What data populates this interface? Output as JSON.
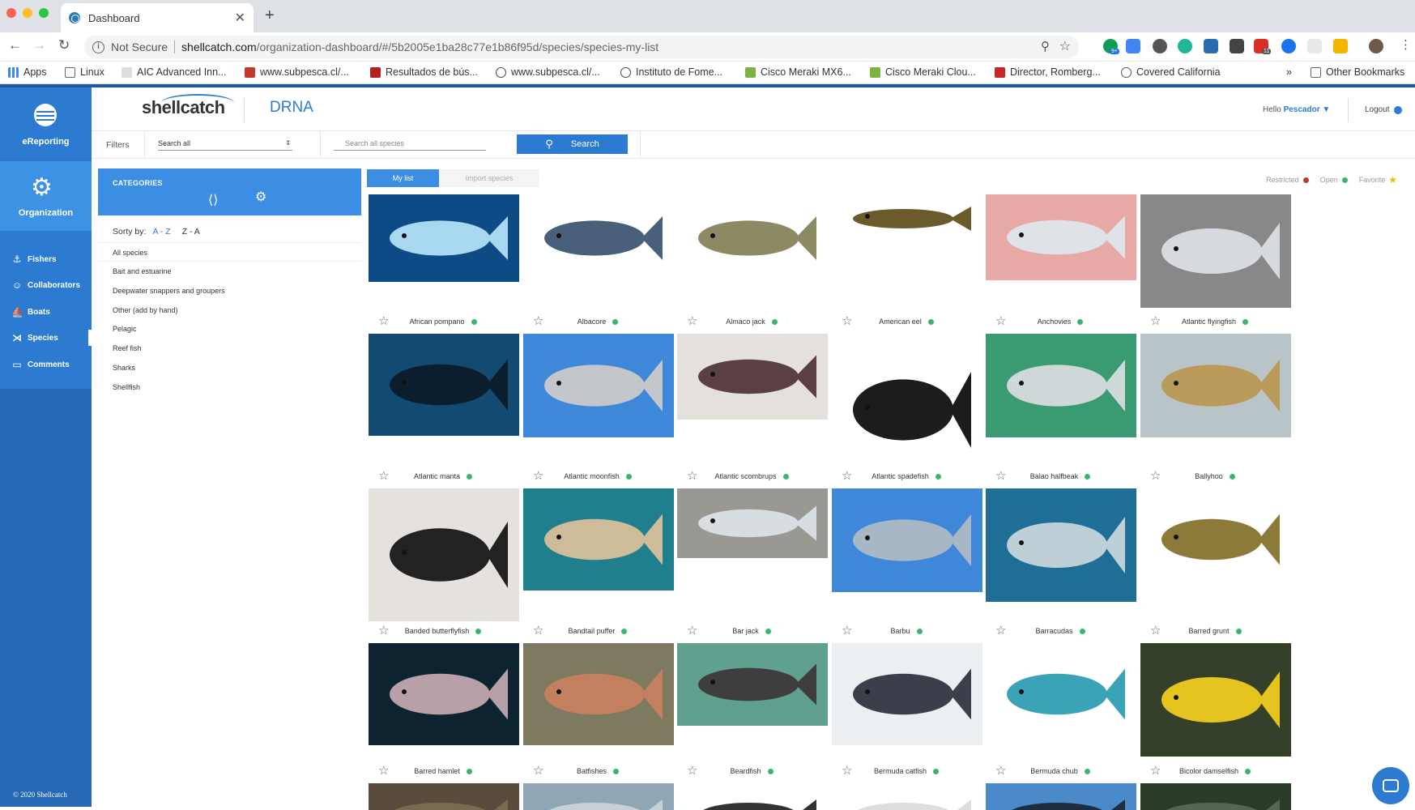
{
  "browser": {
    "tab_title": "Dashboard",
    "security": "Not Secure",
    "url_host": "shellcatch.com",
    "url_path": "/organization-dashboard/#/5b2005e1ba28c77e1b86f95d/species/species-my-list",
    "ext_badge_1": "9+",
    "ext_badge_2": "11",
    "bookmarks": [
      {
        "label": "Apps",
        "color": "#4285f4"
      },
      {
        "label": "Linux",
        "color": "#777777"
      },
      {
        "label": "AIC Advanced Inn...",
        "color": "#555555"
      },
      {
        "label": "www.subpesca.cl/...",
        "color": "#c0392b"
      },
      {
        "label": "Resultados de bús...",
        "color": "#b22222"
      },
      {
        "label": "www.subpesca.cl/...",
        "color": "#444444"
      },
      {
        "label": "Instituto de Fome...",
        "color": "#444444"
      },
      {
        "label": "Cisco Meraki MX6...",
        "color": "#7cb342"
      },
      {
        "label": "Cisco Meraki Clou...",
        "color": "#7cb342"
      },
      {
        "label": "Director, Romberg...",
        "color": "#c62828"
      },
      {
        "label": "Covered California",
        "color": "#555555"
      }
    ],
    "bookmarks_more": "»",
    "other_bookmarks": "Other Bookmarks"
  },
  "sidebar": {
    "top_label": "eReporting",
    "org_label": "Organization",
    "items": [
      {
        "label": "Fishers",
        "icon": "fisher-icon"
      },
      {
        "label": "Collaborators",
        "icon": "user-icon"
      },
      {
        "label": "Boats",
        "icon": "boat-icon"
      },
      {
        "label": "Species",
        "icon": "fish-icon"
      },
      {
        "label": "Comments",
        "icon": "comment-icon"
      }
    ],
    "copyright": "© 2020  Shellcatch"
  },
  "header": {
    "brand": "shellcatch",
    "org": "DRNA",
    "hello": "Hello",
    "user": "Pescador ▼",
    "logout": "Logout"
  },
  "filters": {
    "label": "Filters",
    "select_value": "Search all",
    "search_placeholder": "Search all species",
    "search_button": "Search"
  },
  "categories": {
    "title": "CATEGORIES",
    "sort_label": "Sorty by:",
    "sort_az": "A - Z",
    "sort_za": "Z - A",
    "items": [
      "All species",
      "Bait and estuarine",
      "Deepwater snappers and groupers",
      "Other (add by hand)",
      "Pelagic",
      "Reef fish",
      "Sharks",
      "Shellfish"
    ]
  },
  "tabs": {
    "my_list": "My list",
    "import": "Import species"
  },
  "legend": {
    "restricted": "Restricted",
    "restricted_color": "#c0392b",
    "open": "Open",
    "open_color": "#3cb371",
    "favorite": "Favorite",
    "favorite_color": "#f5b800"
  },
  "species": [
    {
      "name": "African pompano",
      "bg": "#0d4a86",
      "fg": "#a8d8ef"
    },
    {
      "name": "Albacore",
      "bg": "#ffffff",
      "fg": "#48607a"
    },
    {
      "name": "Almaco jack",
      "bg": "#ffffff",
      "fg": "#8c8a62"
    },
    {
      "name": "American eel",
      "bg": "#ffffff",
      "fg": "#6b5a2c"
    },
    {
      "name": "Anchovies",
      "bg": "#e7a9a6",
      "fg": "#dfe3e8"
    },
    {
      "name": "Atlantic flyingfish",
      "bg": "#888888",
      "fg": "#d6d9de"
    },
    {
      "name": "Atlantic manta",
      "bg": "#124a72",
      "fg": "#0b1e2e"
    },
    {
      "name": "Atlantic moonfish",
      "bg": "#3f88d9",
      "fg": "#c3c7cc"
    },
    {
      "name": "Atlantic scombrups",
      "bg": "#e4e0dc",
      "fg": "#5a3f44"
    },
    {
      "name": "Atlantic spadefish",
      "bg": "#ffffff",
      "fg": "#1c1c1c"
    },
    {
      "name": "Balao halfbeak",
      "bg": "#3a9b72",
      "fg": "#cfd8d8"
    },
    {
      "name": "Ballyhoo",
      "bg": "#b9c4c8",
      "fg": "#b99a5a"
    },
    {
      "name": "Banded butterflyfish",
      "bg": "#e5e1dc",
      "fg": "#222222"
    },
    {
      "name": "Bandtail puffer",
      "bg": "#1f7f8c",
      "fg": "#cdbb9a"
    },
    {
      "name": "Bar jack",
      "bg": "#9a9893",
      "fg": "#d7dde0"
    },
    {
      "name": "Barbu",
      "bg": "#3f88d9",
      "fg": "#a7b7c5"
    },
    {
      "name": "Barracudas",
      "bg": "#1e6e96",
      "fg": "#bdd0d8"
    },
    {
      "name": "Barred grunt",
      "bg": "#ffffff",
      "fg": "#8c7a3a"
    },
    {
      "name": "Barred hamlet",
      "bg": "#0d2430",
      "fg": "#b8a0a8"
    },
    {
      "name": "Batfishes",
      "bg": "#7d7a60",
      "fg": "#c2805f"
    },
    {
      "name": "Beardfish",
      "bg": "#5fa08e",
      "fg": "#3e3e3e"
    },
    {
      "name": "Bermuda catfish",
      "bg": "#eceff2",
      "fg": "#3a3f4a"
    },
    {
      "name": "Bermuda chub",
      "bg": "#ffffff",
      "fg": "#3aa3b7"
    },
    {
      "name": "Bicolor damselfish",
      "bg": "#35402a",
      "fg": "#e6c420"
    },
    {
      "name": "",
      "bg": "#5a4c3c",
      "fg": "#7a6a50"
    },
    {
      "name": "",
      "bg": "#8fa6b5",
      "fg": "#c8d0d6"
    },
    {
      "name": "",
      "bg": "#ffffff",
      "fg": "#333333"
    },
    {
      "name": "",
      "bg": "#ffffff",
      "fg": "#dddddd"
    },
    {
      "name": "",
      "bg": "#4a8ac9",
      "fg": "#1e2e3e"
    },
    {
      "name": "",
      "bg": "#2c3a2a",
      "fg": "#556655"
    }
  ]
}
